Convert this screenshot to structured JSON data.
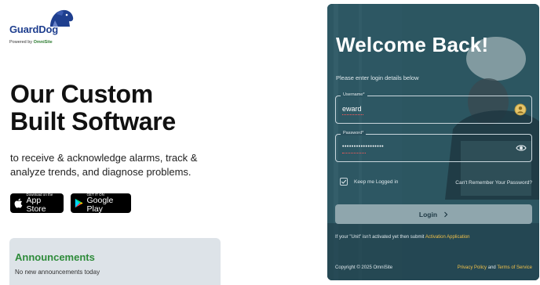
{
  "brand": {
    "name": "GuardDog",
    "powered_prefix": "Powered by",
    "powered_company": "OmniSite"
  },
  "hero": {
    "line1": "Our Custom",
    "line2": "Built Software",
    "description": "to receive & acknowledge alarms, track & analyze trends, and diagnose problems."
  },
  "stores": {
    "apple_small": "Download on the",
    "apple_big": "App Store",
    "google_small": "GET IT ON",
    "google_big": "Google Play"
  },
  "announcements": {
    "title": "Announcements",
    "text": "No new announcements today"
  },
  "login": {
    "welcome": "Welcome Back!",
    "instructions": "Please enter login details below",
    "username_label": "Username*",
    "username_value": "eward",
    "password_label": "Password*",
    "password_value": "••••••••••••••••••",
    "remember_label": "Keep me Logged in",
    "forgot_label": "Can't Remember Your Password?",
    "button_label": "Login",
    "note_prefix": "If your \"Unit\" isn't activated yet then submit",
    "note_link": "Activation Application",
    "copyright": "Copyright © 2025 OmniSite",
    "privacy": "Privacy Policy",
    "and": "and",
    "terms": "Terms of Service"
  },
  "colors": {
    "brand_blue": "#1f3f8f",
    "accent_green": "#2e8b3a",
    "panel_bg": "#2b5561",
    "link_yellow": "#f0c04a"
  },
  "icons": [
    "guard-dog-logo",
    "apple-icon",
    "google-play-icon",
    "user-badge-icon",
    "eye-icon",
    "check-icon",
    "chevron-right-icon"
  ]
}
